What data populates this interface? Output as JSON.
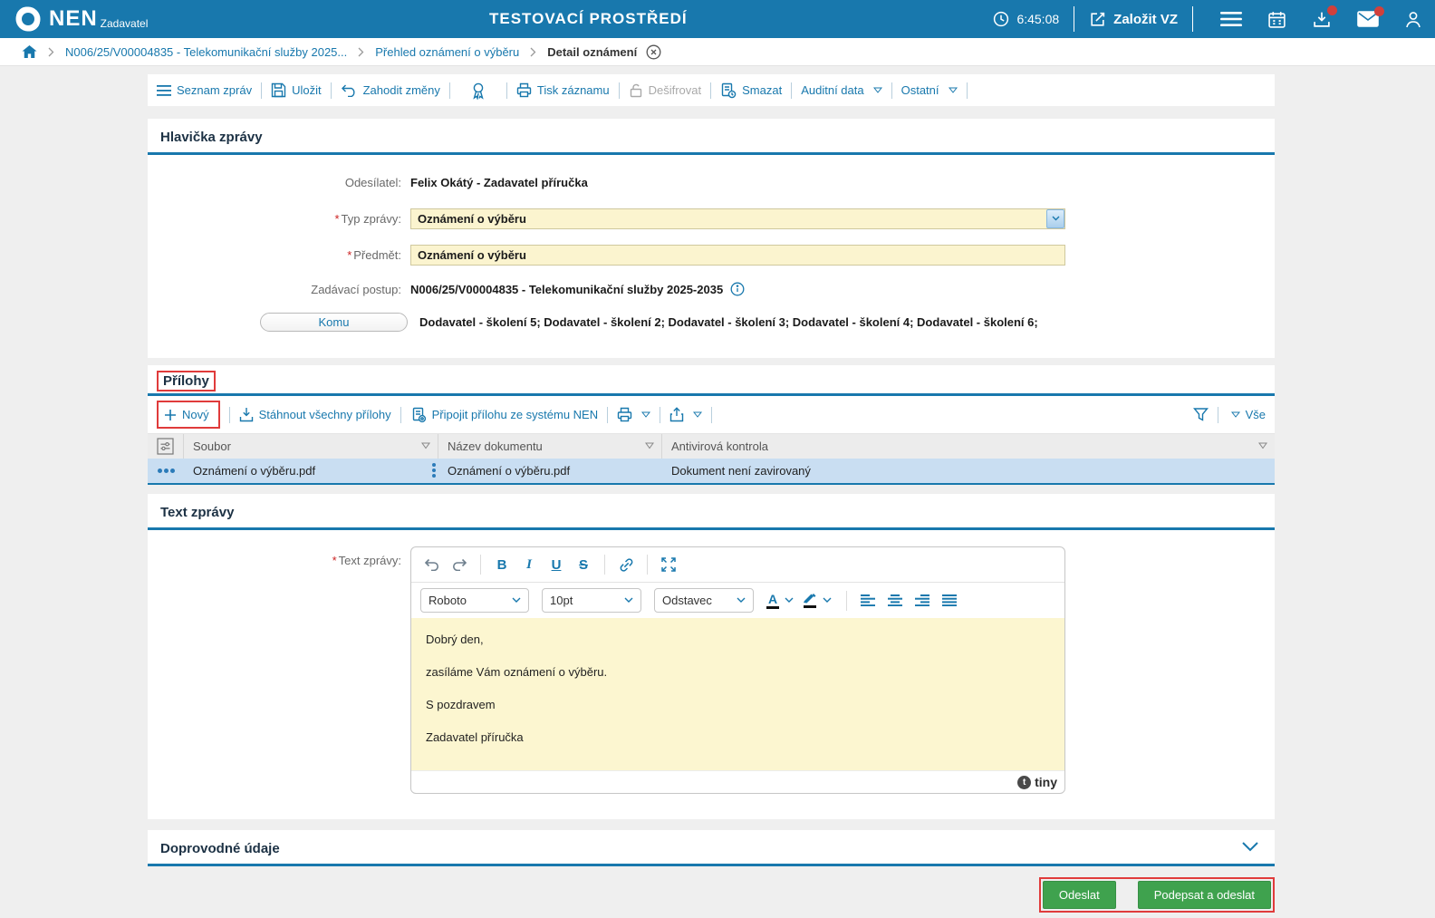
{
  "ui": {
    "required_marker": "*"
  },
  "header": {
    "logo_text": "NEN",
    "logo_subtitle": "Zadavatel",
    "environment_title": "TESTOVACÍ PROSTŘEDÍ",
    "time": "6:45:08",
    "create_vz_label": "Založit VZ"
  },
  "breadcrumb": {
    "items": [
      {
        "label": "N006/25/V00004835 - Telekomunikační služby 2025..."
      },
      {
        "label": "Přehled oznámení o výběru"
      },
      {
        "label": "Detail oznámení"
      }
    ]
  },
  "record_toolbar": {
    "seznam_zprav": "Seznam zpráv",
    "ulozit": "Uložit",
    "zahodit_zmeny": "Zahodit změny",
    "tisk_zaznamu": "Tisk záznamu",
    "desifrovat": "Dešifrovat",
    "smazat": "Smazat",
    "auditni_data": "Auditní data",
    "ostatni": "Ostatní"
  },
  "message_header": {
    "title": "Hlavička zprávy",
    "odesilatel_label": "Odesílatel:",
    "odesilatel_value": "Felix Okátý - Zadavatel příručka",
    "typ_zpravy_label": "Typ zprávy:",
    "typ_zpravy_value": "Oznámení o výběru",
    "predmet_label": "Předmět:",
    "predmet_value": "Oznámení o výběru",
    "zadavaci_postup_label": "Zadávací postup:",
    "zadavaci_postup_value": "N006/25/V00004835 - Telekomunikační služby 2025-2035",
    "komu_label": "Komu",
    "komu_value": "Dodavatel - školení 5; Dodavatel - školení 2; Dodavatel - školení 3; Dodavatel - školení 4; Dodavatel - školení 6;"
  },
  "attachments": {
    "title": "Přílohy",
    "novy": "Nový",
    "stahnout_vse": "Stáhnout všechny přílohy",
    "pripojit": "Připojit přílohu ze systému NEN",
    "filter_all": "Vše",
    "columns": {
      "soubor": "Soubor",
      "nazev": "Název dokumentu",
      "antivir": "Antivirová kontrola"
    },
    "rows": [
      {
        "soubor": "Oznámení o výběru.pdf",
        "nazev": "Oznámení o výběru.pdf",
        "antivir": "Dokument není zavirovaný"
      }
    ]
  },
  "message_text": {
    "title": "Text zprávy",
    "label": "Text zprávy:",
    "editor": {
      "font_name": "Roboto",
      "font_size": "10pt",
      "block_format": "Odstavec",
      "paragraphs": [
        "Dobrý den,",
        "zasíláme Vám oznámení o výběru.",
        "S pozdravem",
        "Zadavatel příručka"
      ],
      "brand": "tiny"
    }
  },
  "accompanying_data": {
    "title": "Doprovodné údaje"
  },
  "actions": {
    "odeslat": "Odeslat",
    "podepsat_a_odeslat": "Podepsat a odeslat"
  },
  "colors": {
    "header_blue": "#1878ad",
    "accent_blue": "#1878ad",
    "field_yellow": "#fbf4cf",
    "selected_row_blue": "#c9def2",
    "annotation_red": "#e03b3b",
    "action_green": "#3fa24e",
    "badge_red": "#d0403c"
  }
}
